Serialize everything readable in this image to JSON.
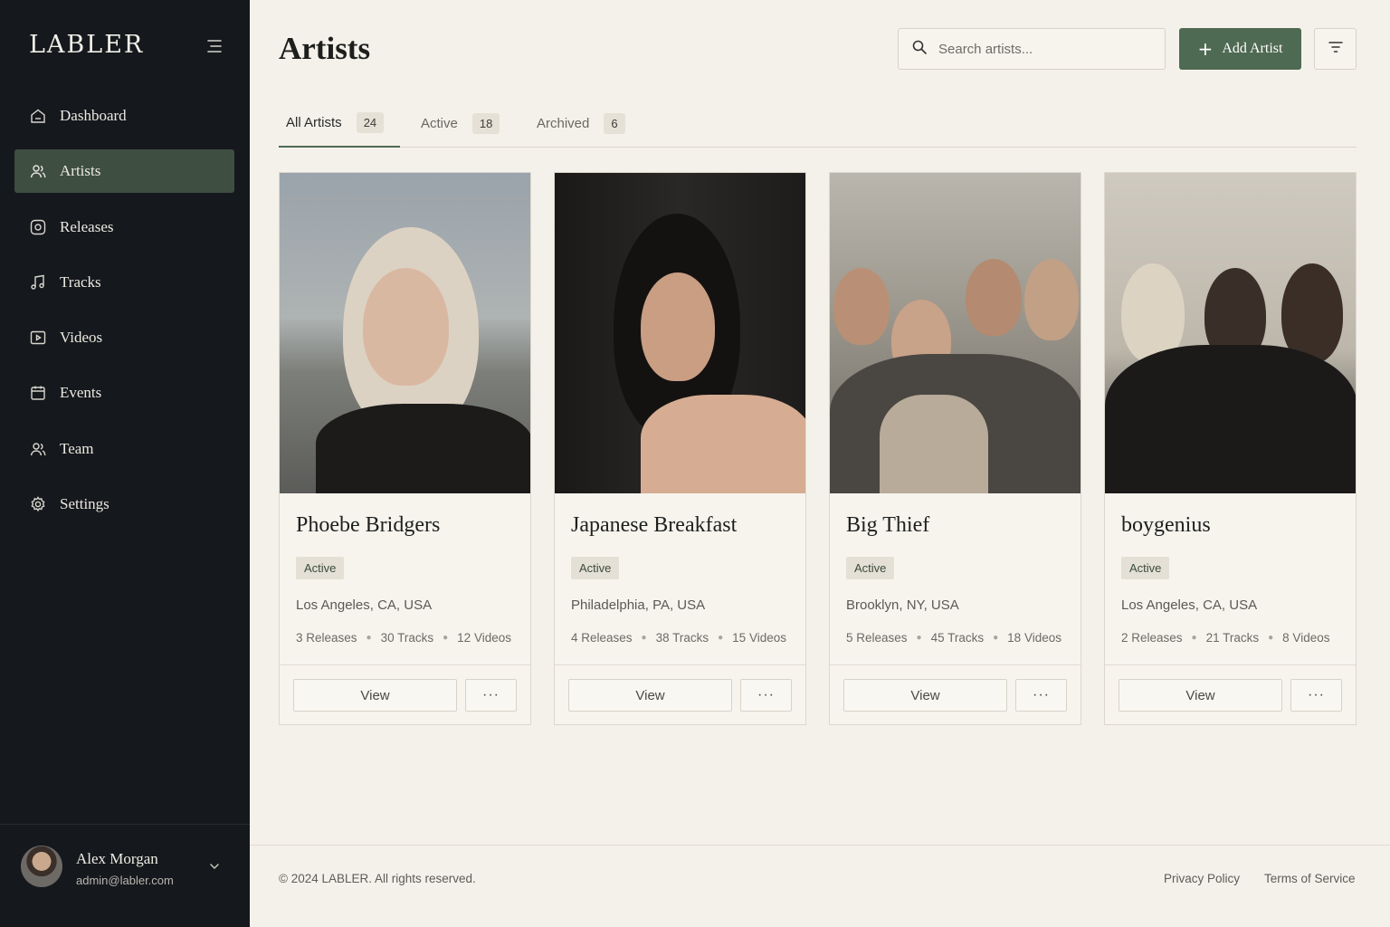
{
  "app": {
    "logo": "LABLER"
  },
  "sidebar": {
    "items": [
      {
        "label": "Dashboard",
        "icon": "home-icon",
        "active": false
      },
      {
        "label": "Artists",
        "icon": "users-icon",
        "active": true
      },
      {
        "label": "Releases",
        "icon": "disc-icon",
        "active": false
      },
      {
        "label": "Tracks",
        "icon": "music-note-icon",
        "active": false
      },
      {
        "label": "Videos",
        "icon": "video-play-icon",
        "active": false
      },
      {
        "label": "Events",
        "icon": "calendar-icon",
        "active": false
      },
      {
        "label": "Team",
        "icon": "team-icon",
        "active": false
      },
      {
        "label": "Settings",
        "icon": "gear-icon",
        "active": false
      }
    ],
    "user": {
      "name": "Alex Morgan",
      "email": "admin@labler.com"
    }
  },
  "header": {
    "title": "Artists",
    "search_placeholder": "Search artists...",
    "add_label": "Add Artist"
  },
  "tabs": [
    {
      "label": "All Artists",
      "count": "24",
      "active": true
    },
    {
      "label": "Active",
      "count": "18",
      "active": false
    },
    {
      "label": "Archived",
      "count": "6",
      "active": false
    }
  ],
  "artists": [
    {
      "name": "Phoebe Bridgers",
      "status": "Active",
      "location": "Los Angeles, CA, USA",
      "releases": "3 Releases",
      "tracks": "30 Tracks",
      "videos": "12 Videos",
      "view_label": "View",
      "more_label": "···"
    },
    {
      "name": "Japanese Breakfast",
      "status": "Active",
      "location": "Philadelphia, PA, USA",
      "releases": "4 Releases",
      "tracks": "38 Tracks",
      "videos": "15 Videos",
      "view_label": "View",
      "more_label": "···"
    },
    {
      "name": "Big Thief",
      "status": "Active",
      "location": "Brooklyn, NY, USA",
      "releases": "5 Releases",
      "tracks": "45 Tracks",
      "videos": "18 Videos",
      "view_label": "View",
      "more_label": "···"
    },
    {
      "name": "boygenius",
      "status": "Active",
      "location": "Los Angeles, CA, USA",
      "releases": "2 Releases",
      "tracks": "21 Tracks",
      "videos": "8 Videos",
      "view_label": "View",
      "more_label": "···"
    }
  ],
  "footer": {
    "copyright": "© 2024 LABLER.  All rights reserved.",
    "privacy": "Privacy Policy",
    "terms": "Terms of Service"
  },
  "colors": {
    "sidebar_bg": "#15181c",
    "accent": "#4f6a53",
    "page_bg": "#f4f1ea"
  }
}
